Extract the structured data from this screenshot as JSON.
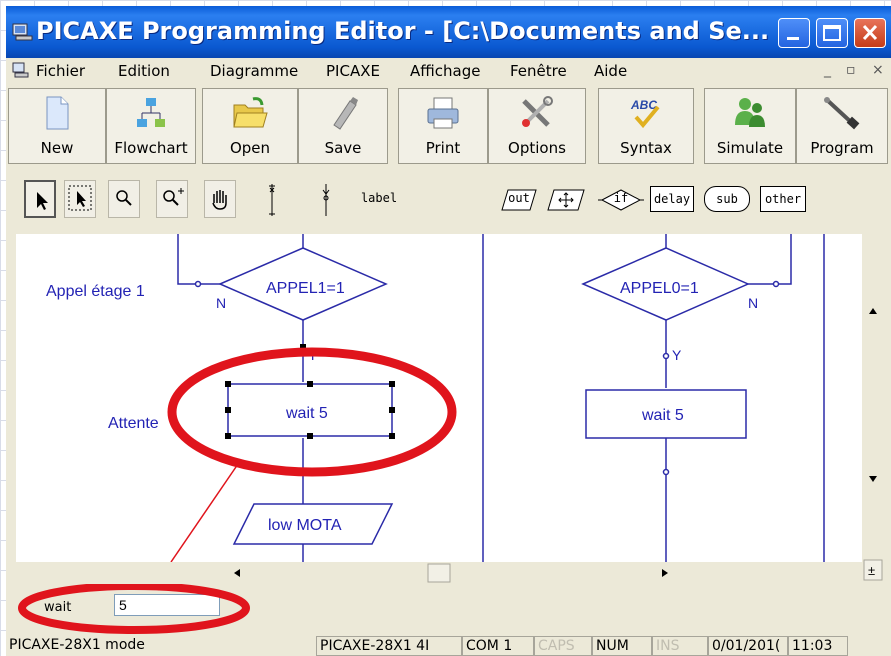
{
  "window": {
    "title": "PICAXE Programming Editor  - [C:\\Documents and Se..."
  },
  "menu": [
    "Fichier",
    "Edition",
    "Diagramme",
    "PICAXE",
    "Affichage",
    "Fenêtre",
    "Aide"
  ],
  "toolbar": {
    "new": "New",
    "flowchart": "Flowchart",
    "open": "Open",
    "save": "Save",
    "print": "Print",
    "options": "Options",
    "syntax": "Syntax",
    "syntax_icon_text": "ABC",
    "simulate": "Simulate",
    "program": "Program"
  },
  "palette": {
    "label": "label",
    "out": "out",
    "if": "if",
    "delay": "delay",
    "sub": "sub",
    "other": "other"
  },
  "flowchart": {
    "left_comment_top": "Appel étage 1",
    "left_comment_mid": "Attente",
    "left_decision": "APPEL1=1",
    "right_decision": "APPEL0=1",
    "left_wait": "wait 5",
    "right_wait": "wait 5",
    "low_box": "low MOTA",
    "n_label": "N",
    "y_label": "Y"
  },
  "properties": {
    "field_label": "wait",
    "field_value": "5"
  },
  "statusbar": {
    "mode": "PICAXE-28X1 mode",
    "chip": "PICAXE-28X1 4I",
    "port": "COM 1",
    "caps": "CAPS",
    "num": "NUM",
    "ins": "INS",
    "date": "0/01/201(",
    "time": "11:03"
  },
  "colors": {
    "titlebar": "#0a58d0",
    "flow_lines": "#2b2ba8",
    "flow_text": "#2323b4",
    "highlight": "#e0141c"
  }
}
